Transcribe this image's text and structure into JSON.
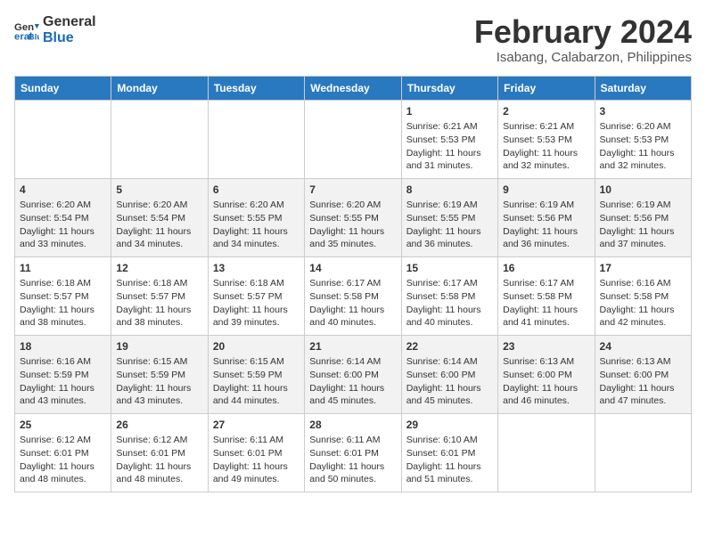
{
  "header": {
    "logo_line1": "General",
    "logo_line2": "Blue",
    "title": "February 2024",
    "subtitle": "Isabang, Calabarzon, Philippines"
  },
  "columns": [
    "Sunday",
    "Monday",
    "Tuesday",
    "Wednesday",
    "Thursday",
    "Friday",
    "Saturday"
  ],
  "weeks": [
    [
      {
        "day": "",
        "info": ""
      },
      {
        "day": "",
        "info": ""
      },
      {
        "day": "",
        "info": ""
      },
      {
        "day": "",
        "info": ""
      },
      {
        "day": "1",
        "info": "Sunrise: 6:21 AM\nSunset: 5:53 PM\nDaylight: 11 hours\nand 31 minutes."
      },
      {
        "day": "2",
        "info": "Sunrise: 6:21 AM\nSunset: 5:53 PM\nDaylight: 11 hours\nand 32 minutes."
      },
      {
        "day": "3",
        "info": "Sunrise: 6:20 AM\nSunset: 5:53 PM\nDaylight: 11 hours\nand 32 minutes."
      }
    ],
    [
      {
        "day": "4",
        "info": "Sunrise: 6:20 AM\nSunset: 5:54 PM\nDaylight: 11 hours\nand 33 minutes."
      },
      {
        "day": "5",
        "info": "Sunrise: 6:20 AM\nSunset: 5:54 PM\nDaylight: 11 hours\nand 34 minutes."
      },
      {
        "day": "6",
        "info": "Sunrise: 6:20 AM\nSunset: 5:55 PM\nDaylight: 11 hours\nand 34 minutes."
      },
      {
        "day": "7",
        "info": "Sunrise: 6:20 AM\nSunset: 5:55 PM\nDaylight: 11 hours\nand 35 minutes."
      },
      {
        "day": "8",
        "info": "Sunrise: 6:19 AM\nSunset: 5:55 PM\nDaylight: 11 hours\nand 36 minutes."
      },
      {
        "day": "9",
        "info": "Sunrise: 6:19 AM\nSunset: 5:56 PM\nDaylight: 11 hours\nand 36 minutes."
      },
      {
        "day": "10",
        "info": "Sunrise: 6:19 AM\nSunset: 5:56 PM\nDaylight: 11 hours\nand 37 minutes."
      }
    ],
    [
      {
        "day": "11",
        "info": "Sunrise: 6:18 AM\nSunset: 5:57 PM\nDaylight: 11 hours\nand 38 minutes."
      },
      {
        "day": "12",
        "info": "Sunrise: 6:18 AM\nSunset: 5:57 PM\nDaylight: 11 hours\nand 38 minutes."
      },
      {
        "day": "13",
        "info": "Sunrise: 6:18 AM\nSunset: 5:57 PM\nDaylight: 11 hours\nand 39 minutes."
      },
      {
        "day": "14",
        "info": "Sunrise: 6:17 AM\nSunset: 5:58 PM\nDaylight: 11 hours\nand 40 minutes."
      },
      {
        "day": "15",
        "info": "Sunrise: 6:17 AM\nSunset: 5:58 PM\nDaylight: 11 hours\nand 40 minutes."
      },
      {
        "day": "16",
        "info": "Sunrise: 6:17 AM\nSunset: 5:58 PM\nDaylight: 11 hours\nand 41 minutes."
      },
      {
        "day": "17",
        "info": "Sunrise: 6:16 AM\nSunset: 5:58 PM\nDaylight: 11 hours\nand 42 minutes."
      }
    ],
    [
      {
        "day": "18",
        "info": "Sunrise: 6:16 AM\nSunset: 5:59 PM\nDaylight: 11 hours\nand 43 minutes."
      },
      {
        "day": "19",
        "info": "Sunrise: 6:15 AM\nSunset: 5:59 PM\nDaylight: 11 hours\nand 43 minutes."
      },
      {
        "day": "20",
        "info": "Sunrise: 6:15 AM\nSunset: 5:59 PM\nDaylight: 11 hours\nand 44 minutes."
      },
      {
        "day": "21",
        "info": "Sunrise: 6:14 AM\nSunset: 6:00 PM\nDaylight: 11 hours\nand 45 minutes."
      },
      {
        "day": "22",
        "info": "Sunrise: 6:14 AM\nSunset: 6:00 PM\nDaylight: 11 hours\nand 45 minutes."
      },
      {
        "day": "23",
        "info": "Sunrise: 6:13 AM\nSunset: 6:00 PM\nDaylight: 11 hours\nand 46 minutes."
      },
      {
        "day": "24",
        "info": "Sunrise: 6:13 AM\nSunset: 6:00 PM\nDaylight: 11 hours\nand 47 minutes."
      }
    ],
    [
      {
        "day": "25",
        "info": "Sunrise: 6:12 AM\nSunset: 6:01 PM\nDaylight: 11 hours\nand 48 minutes."
      },
      {
        "day": "26",
        "info": "Sunrise: 6:12 AM\nSunset: 6:01 PM\nDaylight: 11 hours\nand 48 minutes."
      },
      {
        "day": "27",
        "info": "Sunrise: 6:11 AM\nSunset: 6:01 PM\nDaylight: 11 hours\nand 49 minutes."
      },
      {
        "day": "28",
        "info": "Sunrise: 6:11 AM\nSunset: 6:01 PM\nDaylight: 11 hours\nand 50 minutes."
      },
      {
        "day": "29",
        "info": "Sunrise: 6:10 AM\nSunset: 6:01 PM\nDaylight: 11 hours\nand 51 minutes."
      },
      {
        "day": "",
        "info": ""
      },
      {
        "day": "",
        "info": ""
      }
    ]
  ]
}
